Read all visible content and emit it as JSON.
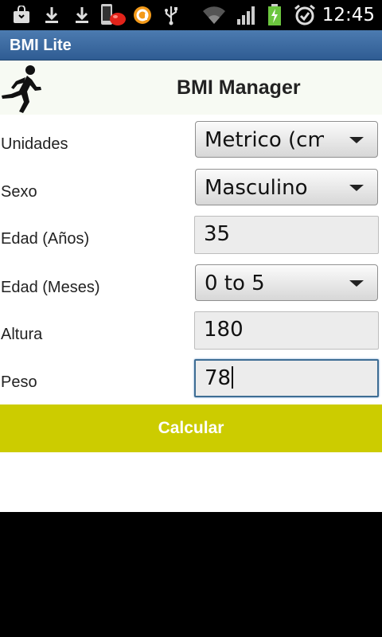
{
  "status_bar": {
    "time": "12:45",
    "icons": [
      "bag-icon",
      "download-icon",
      "download-icon",
      "phone-notification-icon",
      "app-icon",
      "usb-icon",
      "wifi-icon",
      "signal-icon",
      "battery-charging-icon",
      "alarm-icon"
    ]
  },
  "app": {
    "title": "BMI Lite",
    "header_title": "BMI Manager"
  },
  "form": {
    "units": {
      "label": "Unidades",
      "value": "Metrico (cm"
    },
    "sex": {
      "label": "Sexo",
      "value": "Masculino"
    },
    "age_years": {
      "label": "Edad (Años)",
      "value": "35"
    },
    "age_months": {
      "label": "Edad (Meses)",
      "value": "0 to 5"
    },
    "height": {
      "label": "Altura",
      "value": "180"
    },
    "weight": {
      "label": "Peso",
      "value": "78"
    }
  },
  "actions": {
    "calculate_label": "Calcular"
  },
  "colors": {
    "title_bar": "#3a6aa3",
    "calculate_button": "#cccc00",
    "status_bar": "#000000"
  }
}
